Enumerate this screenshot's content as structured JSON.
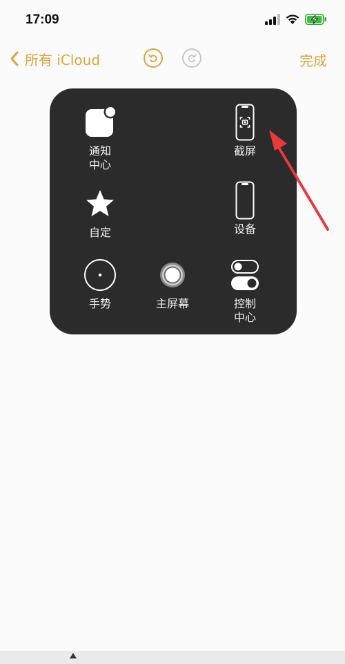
{
  "status_bar": {
    "time": "17:09"
  },
  "nav": {
    "back_label": "所有 iCloud",
    "done_label": "完成"
  },
  "menu": {
    "items": [
      {
        "label": "通知\n中心",
        "icon": "notification-center-icon"
      },
      {
        "label": "截屏",
        "icon": "screenshot-icon"
      },
      {
        "label": "自定",
        "icon": "star-icon"
      },
      {
        "label": "设备",
        "icon": "device-icon"
      },
      {
        "label": "手势",
        "icon": "gesture-icon"
      },
      {
        "label": "主屏幕",
        "icon": "home-icon"
      },
      {
        "label": "控制\n中心",
        "icon": "control-center-icon"
      }
    ]
  },
  "colors": {
    "accent": "#d9a53a",
    "panel_bg": "#2b2b2b",
    "annotation_arrow": "#e8393c"
  }
}
